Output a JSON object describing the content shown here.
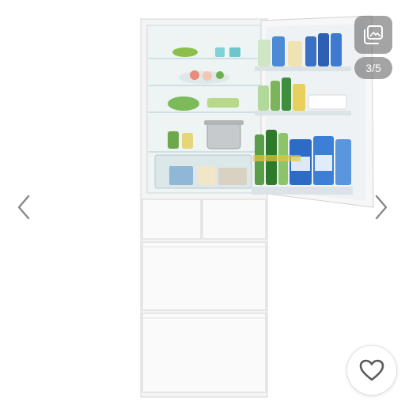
{
  "viewer": {
    "counter_text": "3/5",
    "current_index": 3,
    "total_images": 5
  },
  "icons": {
    "prev": "chevron-left-icon",
    "next": "chevron-right-icon",
    "gallery": "gallery-icon",
    "favorite": "heart-outline-icon"
  },
  "colors": {
    "arrow": "#888888",
    "overlay": "#5a5a5a",
    "fridge_body": "#f6f6f6",
    "accent_green": "#3e8e3c",
    "accent_blue": "#2c6cc4"
  }
}
